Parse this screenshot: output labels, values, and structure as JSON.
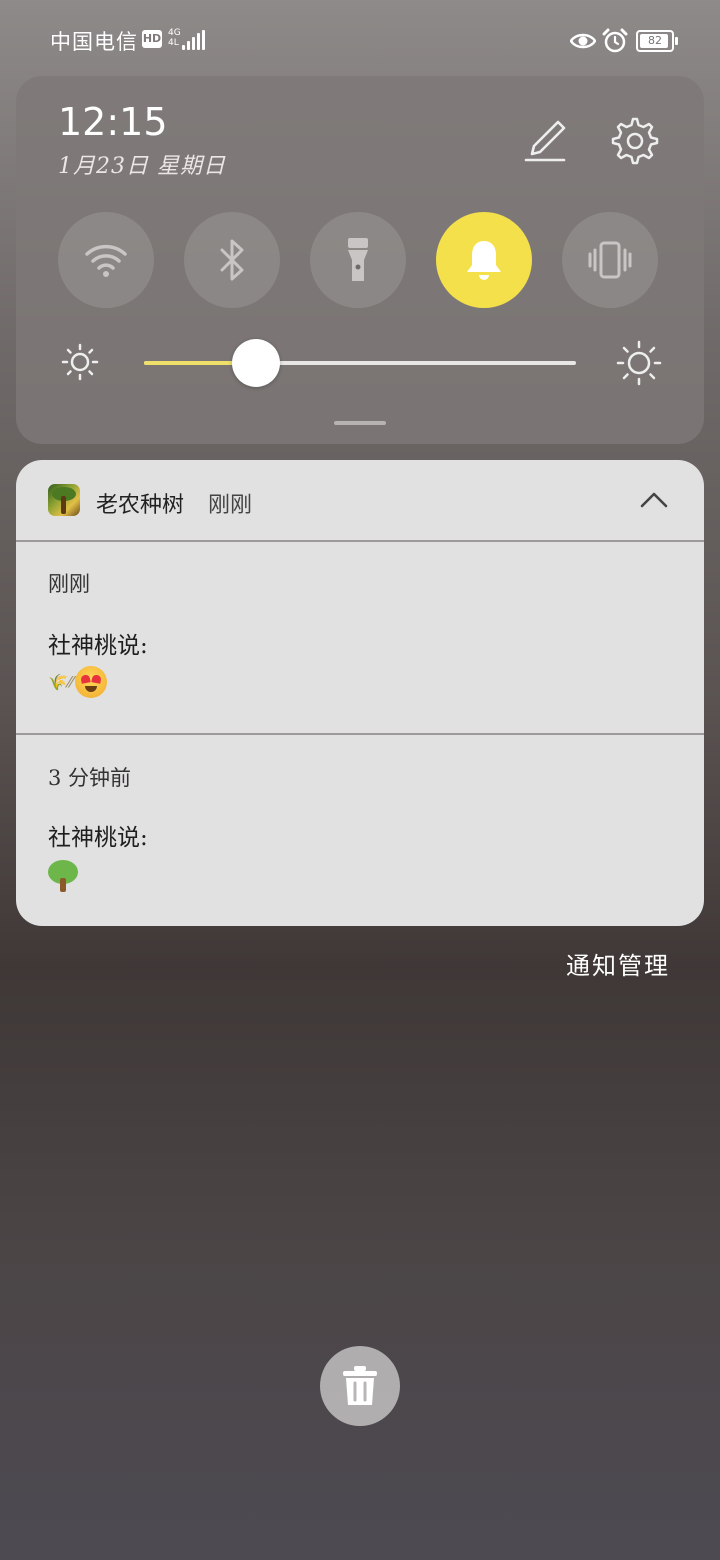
{
  "status_bar": {
    "carrier": "中国电信",
    "hd_badge": "HD",
    "network_type": "4G",
    "network_sub": "4L",
    "battery_level": "82",
    "icons": [
      "eye-icon",
      "alarm-icon",
      "battery-icon",
      "signal-icon"
    ]
  },
  "quick_settings": {
    "time": "12:15",
    "date": "1月23日 星期日",
    "tiles": [
      {
        "name": "wifi",
        "icon": "wifi-icon",
        "active": false
      },
      {
        "name": "bluetooth",
        "icon": "bluetooth-icon",
        "active": false
      },
      {
        "name": "flashlight",
        "icon": "flashlight-icon",
        "active": false
      },
      {
        "name": "sound",
        "icon": "bell-icon",
        "active": true
      },
      {
        "name": "vibrate",
        "icon": "vibrate-icon",
        "active": false
      }
    ],
    "brightness": 0.26,
    "colors": {
      "accent": "#f4e04a",
      "panel": "#7e7978"
    }
  },
  "notification": {
    "app_name": "老农种树",
    "app_time": "刚刚",
    "items": [
      {
        "time": "刚刚",
        "sender": "社神桃说:",
        "body_prefix": "🌾⁄⁄",
        "emoji": "heart-eyes-emoji"
      },
      {
        "time": "3 分钟前",
        "sender": "社神桃说:",
        "emoji": "tree-emoji"
      }
    ]
  },
  "footer": {
    "manage_label": "通知管理",
    "clear_icon": "trash-icon"
  }
}
